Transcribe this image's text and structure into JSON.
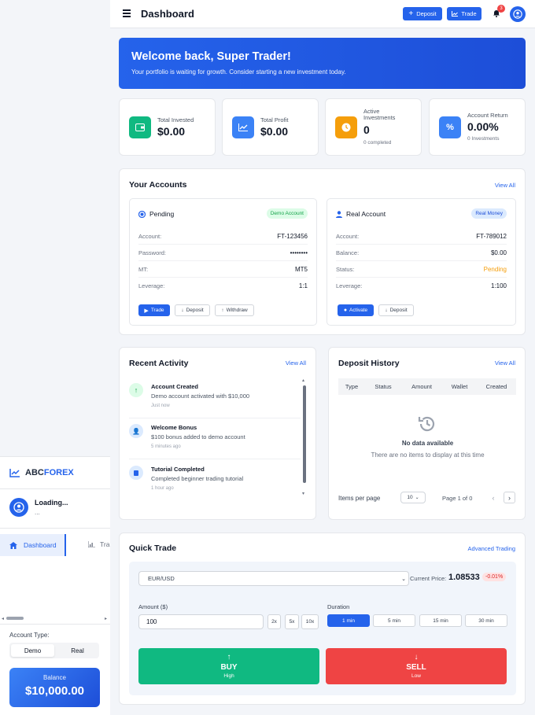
{
  "sidebar": {
    "logo_prefix": "ABC",
    "logo_suffix": "FOREX",
    "user_name": "Loading...",
    "user_sub": "...",
    "nav_active": "Dashboard",
    "nav_next": "Tra",
    "account_type_label": "Account Type:",
    "toggle": [
      "Demo",
      "Real"
    ],
    "balance_label": "Balance",
    "balance_value": "$10,000.00"
  },
  "topbar": {
    "title": "Dashboard",
    "deposit_label": "Deposit",
    "trade_label": "Trade",
    "notif_count": "3"
  },
  "welcome": {
    "title": "Welcome back, Super Trader!",
    "subtitle": "Your portfolio is waiting for growth. Consider starting a new investment today."
  },
  "stats": [
    {
      "label": "Total Invested",
      "value": "$0.00",
      "sub": "",
      "color": "#10b981"
    },
    {
      "label": "Total Profit",
      "value": "$0.00",
      "sub": "",
      "color": "#3b82f6"
    },
    {
      "label_1": "Active",
      "label_2": "Investments",
      "value": "0",
      "sub": "0 completed",
      "color": "#f59e0b"
    },
    {
      "label": "Account Return",
      "value": "0.00%",
      "sub": "0 Investments",
      "color": "#3b82f6"
    }
  ],
  "accounts": {
    "title": "Your Accounts",
    "view_all": "View All",
    "demo": {
      "status": "Pending",
      "badge": "Demo Account",
      "rows": [
        {
          "k": "Account:",
          "v": "FT-123456"
        },
        {
          "k": "Password:",
          "v": "••••••••"
        },
        {
          "k": "MT:",
          "v": "MT5"
        },
        {
          "k": "Leverage:",
          "v": "1:1"
        }
      ],
      "btn_trade": "Trade",
      "btn_deposit": "Deposit",
      "btn_withdraw": "Withdraw"
    },
    "real": {
      "title": "Real Account",
      "badge": "Real Money",
      "rows": [
        {
          "k": "Account:",
          "v": "FT-789012"
        },
        {
          "k": "Balance:",
          "v": "$0.00"
        },
        {
          "k": "Status:",
          "v": "Pending"
        },
        {
          "k": "Leverage:",
          "v": "1:100"
        }
      ],
      "btn_activate": "Activate",
      "btn_deposit": "Deposit"
    }
  },
  "activity": {
    "title": "Recent Activity",
    "view_all": "View All",
    "items": [
      {
        "title": "Account Created",
        "desc": "Demo account activated with $10,000",
        "time": "Just now"
      },
      {
        "title": "Welcome Bonus",
        "desc": "$100 bonus added to demo account",
        "time": "5 minutes ago"
      },
      {
        "title": "Tutorial Completed",
        "desc": "Completed beginner trading tutorial",
        "time": "1 hour ago"
      }
    ]
  },
  "deposits": {
    "title": "Deposit History",
    "view_all": "View All",
    "columns": [
      "Type",
      "Status",
      "Amount",
      "Wallet",
      "Created"
    ],
    "empty_title": "No data available",
    "empty_desc": "There are no items to display at this time",
    "items_per_page_label": "Items per page",
    "items_per_page": "10",
    "page_info": "Page 1 of 0"
  },
  "quick_trade": {
    "title": "Quick Trade",
    "advanced": "Advanced Trading",
    "pair": "EUR/USD",
    "current_price_label": "Current Price:",
    "current_price": "1.08533",
    "change": "-0.01%",
    "amount_label": "Amount ($)",
    "amount_value": "100",
    "multipliers": [
      "2x",
      "5x",
      "10x"
    ],
    "duration_label": "Duration",
    "durations": [
      "1 min",
      "5 min",
      "15 min",
      "30 min"
    ],
    "buy_label": "BUY",
    "buy_sub": "High",
    "sell_label": "SELL",
    "sell_sub": "Low"
  }
}
